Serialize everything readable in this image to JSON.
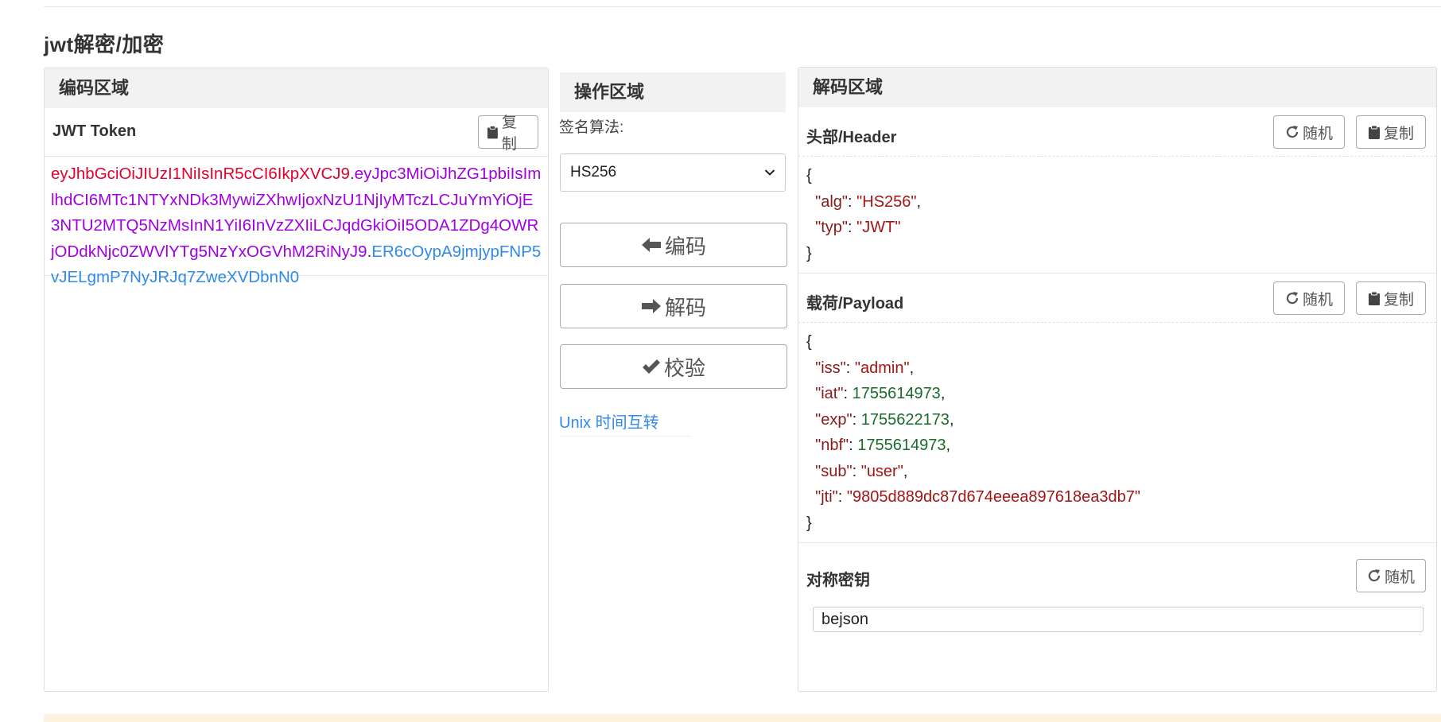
{
  "page": {
    "title": "jwt解密/加密"
  },
  "encode": {
    "heading": "编码区域",
    "token_label": "JWT Token",
    "copy_label": "复制",
    "token": {
      "header": "eyJhbGciOiJIUzI1NiIsInR5cCI6IkpXVCJ9",
      "payload": "eyJpc3MiOiJhZG1pbiIsImlhdCI6MTc1NTYxNDk3MywiZXhwIjoxNzU1NjIyMTczLCJuYmYiOjE3NTU2MTQ5NzMsInN1YiI6InVzZXIiLCJqdGkiOiI5ODA1ZDg4OWRjODdkNjc0ZWVlYTg5NzYxOGVhM2RiNyJ9",
      "signature": "ER6cOypA9jmjypFNP5vJELgmP7NyJRJq7ZweXVDbnN0",
      "dot": "."
    }
  },
  "operations": {
    "heading": "操作区域",
    "algo_label": "签名算法:",
    "algo_value": "HS256",
    "encode_btn": "编码",
    "decode_btn": "解码",
    "verify_btn": "校验",
    "unix_link": "Unix 时间互转"
  },
  "decode": {
    "heading": "解码区域",
    "header_title": "头部/Header",
    "payload_title": "载荷/Payload",
    "key_title": "对称密钥",
    "random_label": "随机",
    "copy_label": "复制",
    "key_value": "bejson",
    "header_json": {
      "alg": "HS256",
      "typ": "JWT"
    },
    "payload_json": {
      "iss": "admin",
      "iat": 1755614973,
      "exp": 1755622173,
      "nbf": 1755614973,
      "sub": "user",
      "jti": "9805d889dc87d674eeea897618ea3db7"
    }
  },
  "colors": {
    "token_header": "#e4002b",
    "token_payload": "#a100e0",
    "token_signature": "#2f8ae8",
    "link": "#2f8ae8"
  }
}
